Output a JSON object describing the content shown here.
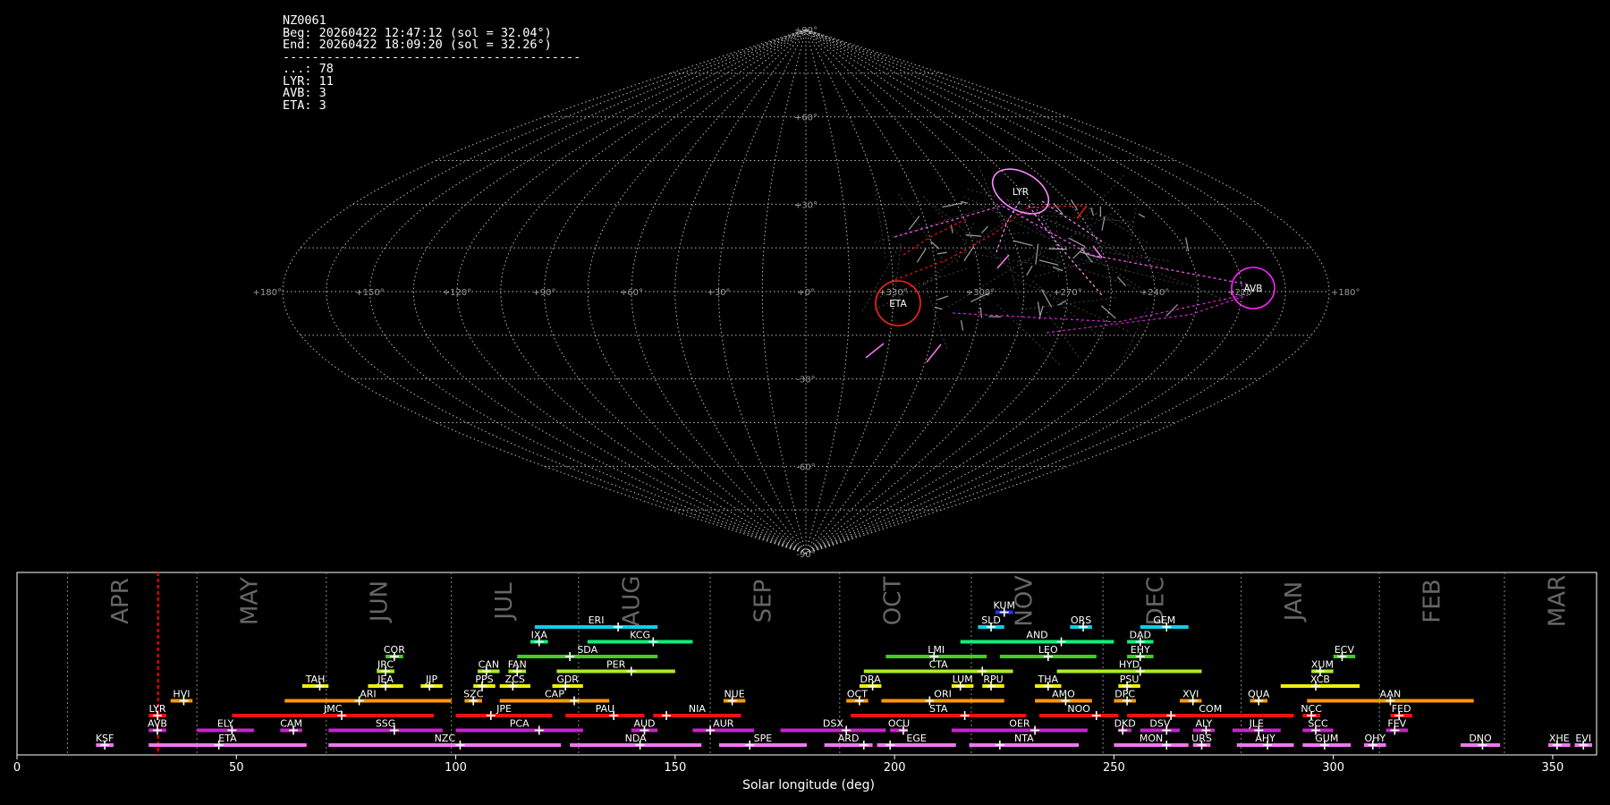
{
  "info": {
    "station": "NZ0061",
    "beg": "Beg: 20260422 12:47:12 (sol = 32.04°)",
    "end": "End: 20260422 18:09:20 (sol = 32.26°)",
    "separator": "-----------------------------------------",
    "counts": [
      "...: 78",
      "LYR: 11",
      "AVB: 3",
      "ETA: 3"
    ]
  },
  "chart_data": [
    {
      "type": "scatter",
      "projection": "sinusoidal",
      "lon_labels": [
        "+180°",
        "+150°",
        "+120°",
        "+90°",
        "+60°",
        "+30°",
        "+0°",
        "+330°",
        "+300°",
        "+270°",
        "+240°",
        "+210°",
        "+180°"
      ],
      "lat_labels": [
        "+90°",
        "+60°",
        "+30°",
        "+0°",
        "-30°",
        "-60°",
        "-90°"
      ],
      "grid": true,
      "radiants": [
        {
          "name": "LYR",
          "lon": 239,
          "lat": 33,
          "color": "#ff88ff",
          "count": 11
        },
        {
          "name": "AVB",
          "lon": 186,
          "lat": 1,
          "color": "#ff22ff",
          "count": 3
        },
        {
          "name": "ETA",
          "lon": 327,
          "lat": -4,
          "color": "#ff2222",
          "count": 3
        }
      ],
      "sporadic_count": 78
    },
    {
      "type": "range",
      "xlabel": "Solar longitude (deg)",
      "xlim": [
        0,
        360
      ],
      "xticks": [
        0,
        50,
        100,
        150,
        200,
        250,
        300,
        350
      ],
      "months": [
        {
          "name": "APR",
          "start": 11.5
        },
        {
          "name": "MAY",
          "start": 41
        },
        {
          "name": "JUN",
          "start": 70.5
        },
        {
          "name": "JUL",
          "start": 99
        },
        {
          "name": "AUG",
          "start": 128
        },
        {
          "name": "SEP",
          "start": 158
        },
        {
          "name": "OCT",
          "start": 187.5
        },
        {
          "name": "NOV",
          "start": 217.5
        },
        {
          "name": "DEC",
          "start": 247.5
        },
        {
          "name": "JAN",
          "start": 279
        },
        {
          "name": "FEB",
          "start": 310.5
        },
        {
          "name": "MAR",
          "start": 339
        }
      ],
      "current_sol": 32.15,
      "colors": {
        "pink": "#ee77ee",
        "violet": "#cc22cc",
        "red": "#ee1111",
        "orange": "#ff9900",
        "yellow": "#eeee11",
        "lime": "#aaee22",
        "green": "#44cc22",
        "spring": "#11ee77",
        "cyan": "#11ccee",
        "blue": "#2233ff"
      },
      "showers": [
        {
          "code": "KSF",
          "start": 18,
          "end": 22,
          "peak": 20,
          "row": 0,
          "color": "pink"
        },
        {
          "code": "ETA",
          "start": 30,
          "end": 66,
          "peak": 46,
          "row": 0,
          "color": "pink"
        },
        {
          "code": "NZC",
          "start": 71,
          "end": 124,
          "peak": 101,
          "row": 0,
          "color": "pink"
        },
        {
          "code": "NDA",
          "start": 126,
          "end": 156,
          "peak": 142,
          "row": 0,
          "color": "pink"
        },
        {
          "code": "SPE",
          "start": 160,
          "end": 180,
          "peak": 167,
          "row": 0,
          "color": "pink"
        },
        {
          "code": "ARD",
          "start": 184,
          "end": 195,
          "peak": 193,
          "row": 0,
          "color": "pink"
        },
        {
          "code": "EGE",
          "start": 196,
          "end": 214,
          "peak": 199,
          "row": 0,
          "color": "pink"
        },
        {
          "code": "NTA",
          "start": 217,
          "end": 242,
          "peak": 224,
          "row": 0,
          "color": "pink"
        },
        {
          "code": "MON",
          "start": 250,
          "end": 267,
          "peak": 262,
          "row": 0,
          "color": "pink"
        },
        {
          "code": "URS",
          "start": 268,
          "end": 272,
          "peak": 270,
          "row": 0,
          "color": "pink"
        },
        {
          "code": "AHY",
          "start": 278,
          "end": 291,
          "peak": 285,
          "row": 0,
          "color": "pink"
        },
        {
          "code": "GUM",
          "start": 293,
          "end": 304,
          "peak": 298,
          "row": 0,
          "color": "pink"
        },
        {
          "code": "OHY",
          "start": 307,
          "end": 312,
          "peak": 309,
          "row": 0,
          "color": "pink"
        },
        {
          "code": "DNO",
          "start": 329,
          "end": 338,
          "peak": 334,
          "row": 0,
          "color": "pink"
        },
        {
          "code": "XHE",
          "start": 349,
          "end": 354,
          "peak": 351,
          "row": 0,
          "color": "pink"
        },
        {
          "code": "EVI",
          "start": 355,
          "end": 359,
          "peak": 357,
          "row": 0,
          "color": "pink"
        },
        {
          "code": "AVB",
          "start": 30,
          "end": 34,
          "peak": 32,
          "row": 1,
          "color": "violet"
        },
        {
          "code": "ELY",
          "start": 41,
          "end": 54,
          "peak": 49,
          "row": 1,
          "color": "violet"
        },
        {
          "code": "CAM",
          "start": 60,
          "end": 65,
          "peak": 63,
          "row": 1,
          "color": "violet"
        },
        {
          "code": "SSG",
          "start": 71,
          "end": 97,
          "peak": 86,
          "row": 1,
          "color": "violet"
        },
        {
          "code": "PCA",
          "start": 100,
          "end": 129,
          "peak": 119,
          "row": 1,
          "color": "violet"
        },
        {
          "code": "AUD",
          "start": 140,
          "end": 146,
          "peak": 143,
          "row": 1,
          "color": "violet"
        },
        {
          "code": "AUR",
          "start": 154,
          "end": 168,
          "peak": 158,
          "row": 1,
          "color": "violet"
        },
        {
          "code": "DSX",
          "start": 174,
          "end": 198,
          "peak": 189,
          "row": 1,
          "color": "violet"
        },
        {
          "code": "OCU",
          "start": 199,
          "end": 203,
          "peak": 202,
          "row": 1,
          "color": "violet"
        },
        {
          "code": "OER",
          "start": 213,
          "end": 244,
          "peak": 232,
          "row": 1,
          "color": "violet"
        },
        {
          "code": "DKD",
          "start": 251,
          "end": 254,
          "peak": 252,
          "row": 1,
          "color": "violet"
        },
        {
          "code": "DSV",
          "start": 256,
          "end": 265,
          "peak": 262,
          "row": 1,
          "color": "violet"
        },
        {
          "code": "ALY",
          "start": 268,
          "end": 273,
          "peak": 271,
          "row": 1,
          "color": "violet"
        },
        {
          "code": "JLE",
          "start": 277,
          "end": 288,
          "peak": 283,
          "row": 1,
          "color": "violet"
        },
        {
          "code": "SCC",
          "start": 293,
          "end": 300,
          "peak": 296,
          "row": 1,
          "color": "violet"
        },
        {
          "code": "FEV",
          "start": 312,
          "end": 317,
          "peak": 314,
          "row": 1,
          "color": "violet"
        },
        {
          "code": "LYR",
          "start": 30,
          "end": 34,
          "peak": 32,
          "row": 2,
          "color": "red"
        },
        {
          "code": "JMC",
          "start": 49,
          "end": 95,
          "peak": 74,
          "row": 2,
          "color": "red"
        },
        {
          "code": "JPE",
          "start": 100,
          "end": 122,
          "peak": 108,
          "row": 2,
          "color": "red"
        },
        {
          "code": "PAU",
          "start": 125,
          "end": 143,
          "peak": 136,
          "row": 2,
          "color": "red"
        },
        {
          "code": "NIA",
          "start": 145,
          "end": 165,
          "peak": 148,
          "row": 2,
          "color": "red"
        },
        {
          "code": "STA",
          "start": 190,
          "end": 230,
          "peak": 216,
          "row": 2,
          "color": "red"
        },
        {
          "code": "NOO",
          "start": 233,
          "end": 251,
          "peak": 246,
          "row": 2,
          "color": "red"
        },
        {
          "code": "COM",
          "start": 253,
          "end": 291,
          "peak": 263,
          "row": 2,
          "color": "red"
        },
        {
          "code": "NCC",
          "start": 293,
          "end": 297,
          "peak": 295,
          "row": 2,
          "color": "red"
        },
        {
          "code": "FED",
          "start": 313,
          "end": 318,
          "peak": 315,
          "row": 2,
          "color": "red"
        },
        {
          "code": "HVI",
          "start": 35,
          "end": 40,
          "peak": 38,
          "row": 3,
          "color": "orange"
        },
        {
          "code": "ARI",
          "start": 61,
          "end": 99,
          "peak": 78,
          "row": 3,
          "color": "orange"
        },
        {
          "code": "SZC",
          "start": 102,
          "end": 106,
          "peak": 104,
          "row": 3,
          "color": "orange"
        },
        {
          "code": "CAP",
          "start": 110,
          "end": 135,
          "peak": 127,
          "row": 3,
          "color": "orange"
        },
        {
          "code": "NUE",
          "start": 161,
          "end": 166,
          "peak": 163,
          "row": 3,
          "color": "orange"
        },
        {
          "code": "OCT",
          "start": 189,
          "end": 194,
          "peak": 192,
          "row": 3,
          "color": "orange"
        },
        {
          "code": "ORI",
          "start": 197,
          "end": 225,
          "peak": 208,
          "row": 3,
          "color": "orange"
        },
        {
          "code": "AMO",
          "start": 232,
          "end": 245,
          "peak": 239,
          "row": 3,
          "color": "orange"
        },
        {
          "code": "DPC",
          "start": 250,
          "end": 255,
          "peak": 253,
          "row": 3,
          "color": "orange"
        },
        {
          "code": "XVI",
          "start": 265,
          "end": 270,
          "peak": 268,
          "row": 3,
          "color": "orange"
        },
        {
          "code": "QUA",
          "start": 281,
          "end": 285,
          "peak": 283,
          "row": 3,
          "color": "orange"
        },
        {
          "code": "AAN",
          "start": 294,
          "end": 332,
          "peak": 313,
          "row": 3,
          "color": "orange"
        },
        {
          "code": "TAH",
          "start": 65,
          "end": 71,
          "peak": 69,
          "row": 4,
          "color": "yellow"
        },
        {
          "code": "JEA",
          "start": 80,
          "end": 88,
          "peak": 84,
          "row": 4,
          "color": "yellow"
        },
        {
          "code": "JIP",
          "start": 92,
          "end": 97,
          "peak": 94,
          "row": 4,
          "color": "yellow"
        },
        {
          "code": "PPS",
          "start": 104,
          "end": 109,
          "peak": 106,
          "row": 4,
          "color": "yellow"
        },
        {
          "code": "ZCS",
          "start": 110,
          "end": 117,
          "peak": 113,
          "row": 4,
          "color": "yellow"
        },
        {
          "code": "GDR",
          "start": 122,
          "end": 129,
          "peak": 125,
          "row": 4,
          "color": "yellow"
        },
        {
          "code": "DRA",
          "start": 192,
          "end": 197,
          "peak": 195,
          "row": 4,
          "color": "yellow"
        },
        {
          "code": "LUM",
          "start": 213,
          "end": 218,
          "peak": 215,
          "row": 4,
          "color": "yellow"
        },
        {
          "code": "RPU",
          "start": 220,
          "end": 225,
          "peak": 222,
          "row": 4,
          "color": "yellow"
        },
        {
          "code": "THA",
          "start": 232,
          "end": 238,
          "peak": 235,
          "row": 4,
          "color": "yellow"
        },
        {
          "code": "PSU",
          "start": 251,
          "end": 256,
          "peak": 253,
          "row": 4,
          "color": "yellow"
        },
        {
          "code": "XCB",
          "start": 288,
          "end": 306,
          "peak": 296,
          "row": 4,
          "color": "yellow"
        },
        {
          "code": "JRC",
          "start": 82,
          "end": 86,
          "peak": 84,
          "row": 5,
          "color": "lime"
        },
        {
          "code": "CAN",
          "start": 105,
          "end": 110,
          "peak": 107,
          "row": 5,
          "color": "lime"
        },
        {
          "code": "FAN",
          "start": 112,
          "end": 116,
          "peak": 114,
          "row": 5,
          "color": "lime"
        },
        {
          "code": "PER",
          "start": 123,
          "end": 150,
          "peak": 140,
          "row": 5,
          "color": "lime"
        },
        {
          "code": "CTA",
          "start": 193,
          "end": 227,
          "peak": 220,
          "row": 5,
          "color": "lime"
        },
        {
          "code": "HYD",
          "start": 237,
          "end": 270,
          "peak": 256,
          "row": 5,
          "color": "lime"
        },
        {
          "code": "XUM",
          "start": 295,
          "end": 300,
          "peak": 297,
          "row": 5,
          "color": "lime"
        },
        {
          "code": "COR",
          "start": 84,
          "end": 88,
          "peak": 86,
          "row": 6,
          "color": "green"
        },
        {
          "code": "SDA",
          "start": 114,
          "end": 146,
          "peak": 126,
          "row": 6,
          "color": "green"
        },
        {
          "code": "LMI",
          "start": 198,
          "end": 221,
          "peak": 209,
          "row": 6,
          "color": "green"
        },
        {
          "code": "LEO",
          "start": 224,
          "end": 246,
          "peak": 235,
          "row": 6,
          "color": "green"
        },
        {
          "code": "EHY",
          "start": 253,
          "end": 259,
          "peak": 256,
          "row": 6,
          "color": "green"
        },
        {
          "code": "ECV",
          "start": 300,
          "end": 305,
          "peak": 302,
          "row": 6,
          "color": "green"
        },
        {
          "code": "IXA",
          "start": 117,
          "end": 121,
          "peak": 119,
          "row": 7,
          "color": "spring"
        },
        {
          "code": "KCG",
          "start": 130,
          "end": 154,
          "peak": 145,
          "row": 7,
          "color": "spring"
        },
        {
          "code": "AND",
          "start": 215,
          "end": 250,
          "peak": 238,
          "row": 7,
          "color": "spring"
        },
        {
          "code": "DAD",
          "start": 253,
          "end": 259,
          "peak": 256,
          "row": 7,
          "color": "spring"
        },
        {
          "code": "ERI",
          "start": 118,
          "end": 146,
          "peak": 137,
          "row": 8,
          "color": "cyan"
        },
        {
          "code": "SLD",
          "start": 219,
          "end": 225,
          "peak": 222,
          "row": 8,
          "color": "cyan"
        },
        {
          "code": "ORS",
          "start": 240,
          "end": 245,
          "peak": 243,
          "row": 8,
          "color": "cyan"
        },
        {
          "code": "GEM",
          "start": 256,
          "end": 267,
          "peak": 262,
          "row": 8,
          "color": "cyan"
        },
        {
          "code": "KUM",
          "start": 223,
          "end": 227,
          "peak": 225,
          "row": 9,
          "color": "blue"
        }
      ]
    }
  ]
}
